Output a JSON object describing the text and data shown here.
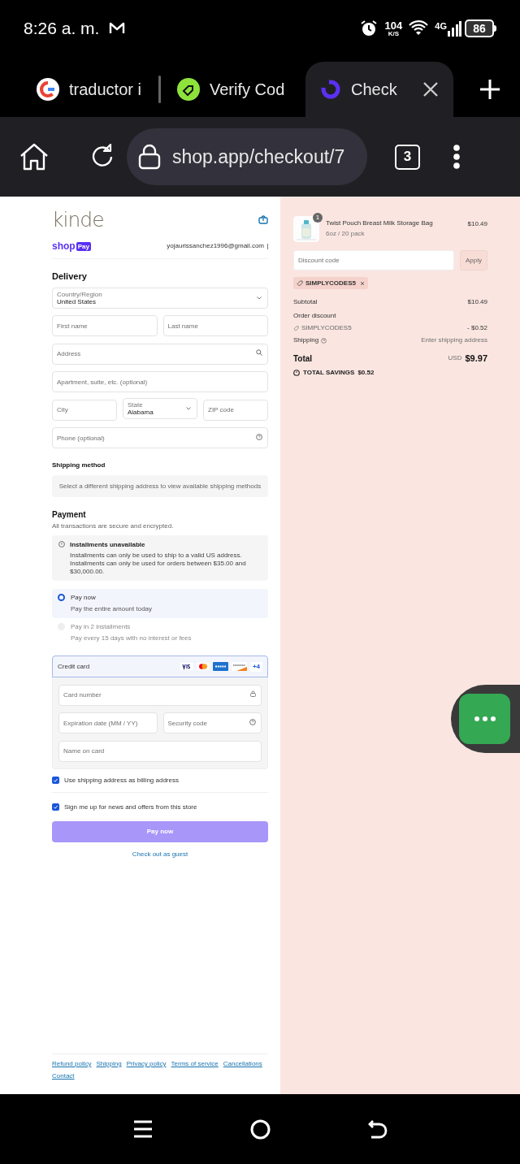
{
  "status_bar": {
    "time": "8:26 a. m.",
    "speed_value": "104",
    "speed_unit": "K/S",
    "network": "4G",
    "battery": "86"
  },
  "browser": {
    "tabs": [
      {
        "title": "traductor i",
        "kind": "google",
        "selected": false
      },
      {
        "title": "Verify Cod",
        "kind": "tag",
        "selected": false
      },
      {
        "title": "Check",
        "kind": "shop",
        "selected": true
      }
    ],
    "url": "shop.app/checkout/7",
    "tab_count": "3"
  },
  "checkout": {
    "logo": "kinde",
    "shop_pay": {
      "shop": "shop",
      "pay": "Pay"
    },
    "email": "yojaurissanchez1996@gmail.com",
    "delivery": {
      "heading": "Delivery",
      "rows": [
        [
          {
            "kind": "select",
            "label": "Country/Region",
            "value": "United States"
          }
        ],
        [
          {
            "kind": "text",
            "placeholder": "First name"
          },
          {
            "kind": "text",
            "placeholder": "Last name"
          }
        ],
        [
          {
            "kind": "search",
            "placeholder": "Address"
          }
        ],
        [
          {
            "kind": "text",
            "placeholder": "Apartment, suite, etc. (optional)"
          }
        ],
        [
          {
            "kind": "text",
            "placeholder": "City"
          },
          {
            "kind": "select",
            "label": "State",
            "value": "Alabama"
          },
          {
            "kind": "text",
            "placeholder": "ZIP code"
          }
        ],
        [
          {
            "kind": "help",
            "placeholder": "Phone (optional)"
          }
        ]
      ]
    },
    "shipping_method": {
      "heading": "Shipping method",
      "notice": "Select a different shipping address to view available shipping methods"
    },
    "payment": {
      "heading": "Payment",
      "subtitle": "All transactions are secure and encrypted.",
      "notice": {
        "title": "Installments unavailable",
        "lines": [
          "Installments can only be used to ship to a valid US address.",
          "Installments can only be used for orders between $35.00 and $30,000.00."
        ]
      },
      "options": [
        {
          "label": "Pay now",
          "description": "Pay the entire amount today",
          "selected": true,
          "disabled": false
        },
        {
          "label": "Pay in 2 installments",
          "description": "Pay every 15 days with no interest or fees",
          "selected": false,
          "disabled": true
        }
      ],
      "credit_card": {
        "label": "Credit card",
        "more_cards": "+4",
        "rows": [
          [
            {
              "kind": "lock",
              "placeholder": "Card number"
            }
          ],
          [
            {
              "kind": "text",
              "placeholder": "Expiration date (MM / YY)"
            },
            {
              "kind": "help",
              "placeholder": "Security code"
            }
          ],
          [
            {
              "kind": "text",
              "placeholder": "Name on card"
            }
          ]
        ]
      },
      "checkboxes": [
        {
          "label": "Use shipping address as billing address",
          "checked": true
        },
        {
          "label": "Sign me up for news and offers from this store",
          "checked": true
        }
      ],
      "pay_button": "Pay now",
      "guest_link": "Check out as guest"
    },
    "footer_links": [
      "Refund policy",
      "Shipping",
      "Privacy policy",
      "Terms of service",
      "Cancellations",
      "Contact"
    ]
  },
  "summary": {
    "item": {
      "quantity": "1",
      "name": "Twist Pouch Breast Milk Storage Bag",
      "variant": "6oz / 20 pack",
      "price": "$10.49"
    },
    "discount": {
      "placeholder": "Discount code",
      "button": "Apply"
    },
    "applied_code": "SIMPLYCODES5",
    "subtotal": {
      "label": "Subtotal",
      "value": "$10.49"
    },
    "order_discount": {
      "label": "Order discount",
      "code": "SIMPLYCODES5",
      "value": "- $0.52"
    },
    "shipping": {
      "label": "Shipping",
      "value": "Enter shipping address"
    },
    "total": {
      "label": "Total",
      "currency": "USD",
      "value": "$9.97"
    },
    "savings": {
      "label": "TOTAL SAVINGS",
      "value": "$0.52"
    }
  }
}
